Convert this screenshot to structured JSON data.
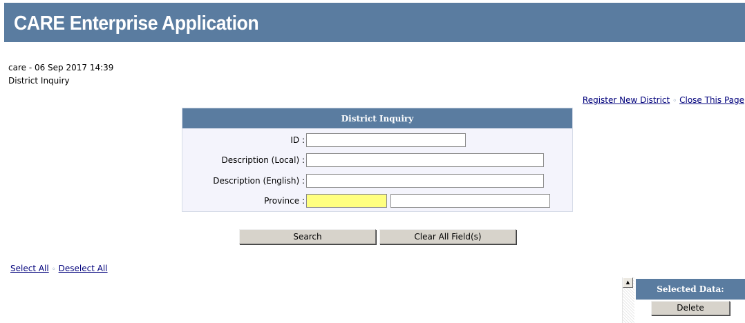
{
  "app": {
    "title": "CARE Enterprise Application"
  },
  "session": {
    "user_line": "care - 06 Sep 2017 14:39",
    "page_name": "District Inquiry"
  },
  "top_links": {
    "register": "Register New District",
    "close": "Close This Page",
    "separator": "◦"
  },
  "form": {
    "header": "District Inquiry",
    "fields": [
      {
        "label": "ID :",
        "value": ""
      },
      {
        "label": "Description (Local) :",
        "value": ""
      },
      {
        "label": "Description (English) :",
        "value": ""
      },
      {
        "label": "Province :",
        "code_value": "",
        "name_value": ""
      }
    ],
    "required_color": "#ffff80"
  },
  "buttons": {
    "search": "Search",
    "clear": "Clear All Field(s)"
  },
  "selection_links": {
    "select_all": "Select All",
    "deselect_all": "Deselect All",
    "separator": "◦"
  },
  "selected_panel": {
    "header": "Selected Data:",
    "delete_label": "Delete"
  },
  "scrollbar": {
    "up_glyph": "▲"
  },
  "colors": {
    "banner": "#5a7ca0",
    "link": "#00007b",
    "form_bg": "#f4f4fc"
  }
}
